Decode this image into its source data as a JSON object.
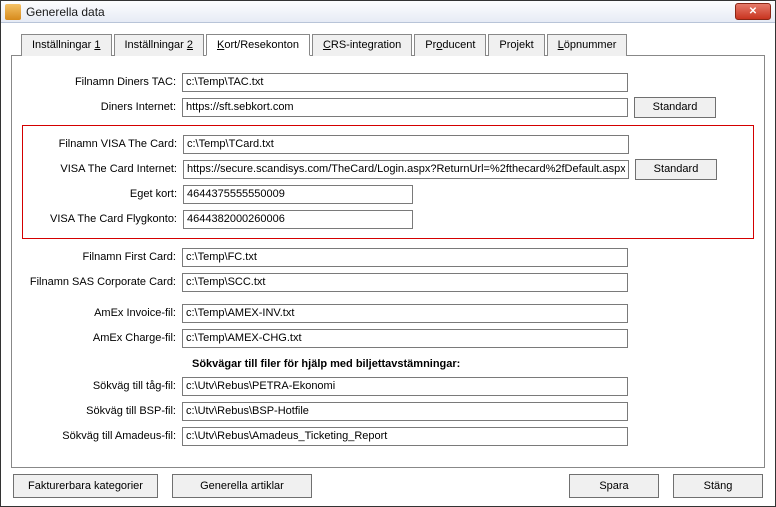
{
  "window": {
    "title": "Generella data"
  },
  "tabs": [
    {
      "prefix": "Inställningar ",
      "ul": "1"
    },
    {
      "prefix": "Inställningar ",
      "ul": "2"
    },
    {
      "prefix": "",
      "ul": "K",
      "suffix": "ort/Resekonton",
      "active": true
    },
    {
      "prefix": "",
      "ul": "C",
      "suffix": "RS-integration"
    },
    {
      "prefix": "Pr",
      "ul": "o",
      "suffix": "ducent"
    },
    {
      "prefix": "Pro",
      "ul": "j",
      "suffix": "ekt"
    },
    {
      "prefix": "",
      "ul": "L",
      "suffix": "öpnummer"
    }
  ],
  "fields": {
    "diners_tac": {
      "label": "Filnamn Diners TAC:",
      "value": "c:\\Temp\\TAC.txt"
    },
    "diners_internet": {
      "label": "Diners Internet:",
      "value": "https://sft.sebkort.com"
    },
    "visa_filnamn": {
      "label": "Filnamn VISA The Card:",
      "value": "c:\\Temp\\TCard.txt"
    },
    "visa_internet": {
      "label": "VISA The Card Internet:",
      "value": "https://secure.scandisys.com/TheCard/Login.aspx?ReturnUrl=%2fthecard%2fDefault.aspx"
    },
    "eget_kort": {
      "label": "Eget kort:",
      "value": "4644375555550009"
    },
    "visa_flygkonto": {
      "label": "VISA The Card Flygkonto:",
      "value": "4644382000260006"
    },
    "first_card": {
      "label": "Filnamn First Card:",
      "value": "c:\\Temp\\FC.txt"
    },
    "sas_corp": {
      "label": "Filnamn SAS Corporate Card:",
      "value": "c:\\Temp\\SCC.txt"
    },
    "amex_inv": {
      "label": "AmEx Invoice-fil:",
      "value": "c:\\Temp\\AMEX-INV.txt"
    },
    "amex_chg": {
      "label": "AmEx Charge-fil:",
      "value": "c:\\Temp\\AMEX-CHG.txt"
    },
    "tag_fil": {
      "label": "Sökväg till tåg-fil:",
      "value": "c:\\Utv\\Rebus\\PETRA-Ekonomi"
    },
    "bsp_fil": {
      "label": "Sökväg till BSP-fil:",
      "value": "c:\\Utv\\Rebus\\BSP-Hotfile"
    },
    "amadeus_fil": {
      "label": "Sökväg till Amadeus-fil:",
      "value": "c:\\Utv\\Rebus\\Amadeus_Ticketing_Report"
    }
  },
  "section_heading": "Sökvägar till filer för hjälp med biljettavstämningar:",
  "buttons": {
    "standard": "Standard",
    "fakturerbara": "Fakturerbara kategorier",
    "generella_artiklar": "Generella artiklar",
    "spara": "Spara",
    "stang": "Stäng",
    "close_x": "✕"
  }
}
